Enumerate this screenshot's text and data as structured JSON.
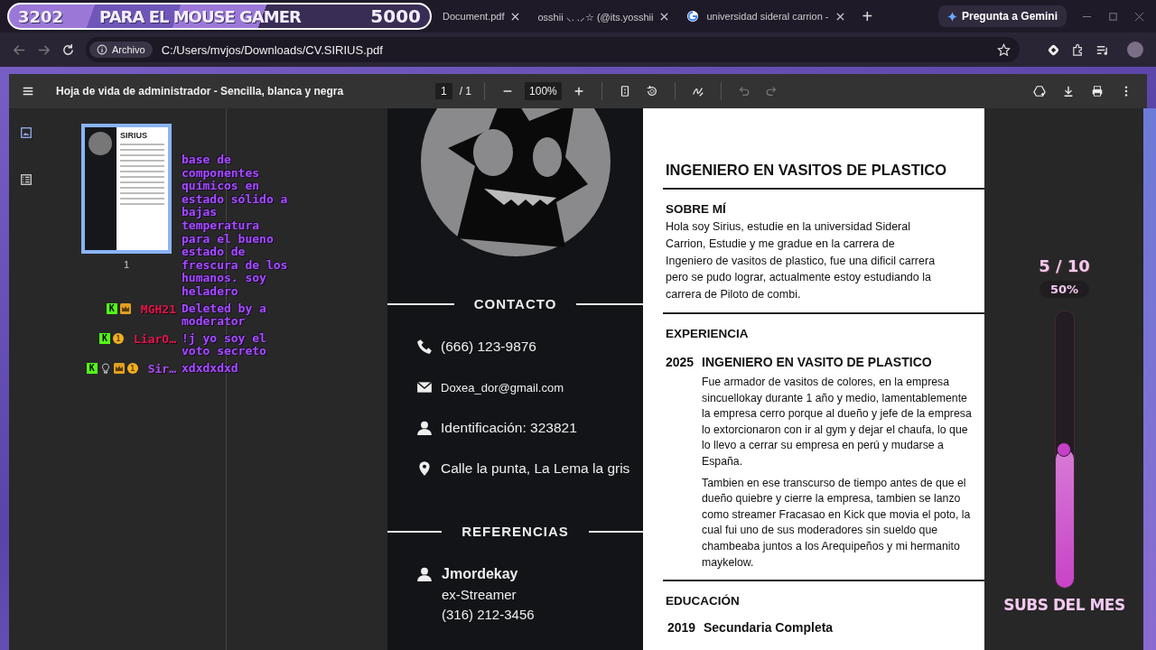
{
  "stream_overlay": {
    "count": "3202",
    "title": "PARA EL MOUSE GAMER",
    "goal": "5000"
  },
  "tabs": [
    {
      "title": "Document.pdf",
      "selected": false
    },
    {
      "title": "osshii ⸜. .⸝☆ (@its.yosshii",
      "selected": false
    },
    {
      "title": "universidad sideral carrion -",
      "selected": false
    }
  ],
  "new_tab": "+",
  "gemini_button": "Pregunta a Gemini",
  "address_bar": {
    "chip": "Archivo",
    "url": "C:/Users/mvjos/Downloads/CV.SIRIUS.pdf"
  },
  "pdf_toolbar": {
    "title": "Hoja de vida de administrador - Sencilla, blanca y negra",
    "page": "1",
    "page_total": "/ 1",
    "zoom": "100%"
  },
  "sidebar": {
    "thumbnails": [
      {
        "title": "SIRIUS",
        "page": "1",
        "selected": true
      }
    ]
  },
  "chat": [
    {
      "text": "base de componentes químicos en estado sólido a bajas temperatura para el bueno estado de frescura de los humanos. soy heladero"
    },
    {
      "badges": [
        {
          "kind": "kick",
          "text": "K"
        },
        {
          "kind": "crown"
        }
      ],
      "user": "MGH21",
      "color": "#e0174a",
      "text": "Deleted by a moderator"
    },
    {
      "badges": [
        {
          "kind": "kick",
          "text": "K"
        },
        {
          "kind": "coin",
          "text": "1"
        }
      ],
      "user": "LiarO…",
      "color": "#e0174a",
      "text": "!j yo soy el voto secreto"
    },
    {
      "badges": [
        {
          "kind": "kick",
          "text": "K"
        },
        {
          "kind": "bulb"
        },
        {
          "kind": "crown"
        },
        {
          "kind": "coin",
          "text": "1"
        }
      ],
      "user": "Sir…",
      "color": "#a64dff",
      "text": "xdxdxdxd"
    }
  ],
  "cv": {
    "contact_heading": "CONTACTO",
    "contacts": [
      {
        "kind": "phone",
        "text": "(666) 123-9876"
      },
      {
        "kind": "email",
        "text": "Doxea_dor@gmail.com"
      },
      {
        "kind": "person",
        "text": "Identificación: 323821"
      },
      {
        "kind": "pin",
        "text": "Calle la punta, La Lema la gris"
      }
    ],
    "references_heading": "REFERENCIAS",
    "references": [
      {
        "name": "Jmordekay",
        "role": "ex-Streamer",
        "phone": "(316) 212-3456"
      }
    ],
    "job_title": "INGENIERO EN VASITOS DE PLASTICO",
    "about_heading": "SOBRE MÍ",
    "about": "Hola soy Sirius, estudie en la universidad Sideral Carrion, Estudie y me gradue en la carrera de Ingeniero de vasitos de plastico, fue una dificil carrera pero se pudo lograr, actualmente estoy estudiando la carrera de Piloto de combi.",
    "experience_heading": "EXPERIENCIA",
    "experience": [
      {
        "year": "2025",
        "title": "INGENIERO EN VASITO DE PLASTICO",
        "paragraphs": [
          "Fue armador de vasitos de colores, en la empresa sincuellokay durante 1 año y medio, lamentablemente la empresa cerro porque al dueño y jefe de la empresa lo extorcionaron con ir al gym y dejar el chaufa, lo que lo llevo a cerrar su empresa en perú y mudarse a España.",
          "Tambien en ese transcurso de tiempo antes de que el dueño quiebre y cierre la empresa, tambien se lanzo como streamer Fracasao en Kick que movia el poto, la cual fui uno de sus moderadores sin sueldo que chambeaba juntos a los Arequipeños y mi hermanito maykelow."
        ]
      }
    ],
    "education_heading": "EDUCACIÓN",
    "education": [
      {
        "year": "2019",
        "title": "Secundaria Completa"
      }
    ]
  },
  "subs_goal": {
    "count": "5 / 10",
    "percent": "50%",
    "level": 0.5,
    "label": "SUBS DEL MES"
  }
}
